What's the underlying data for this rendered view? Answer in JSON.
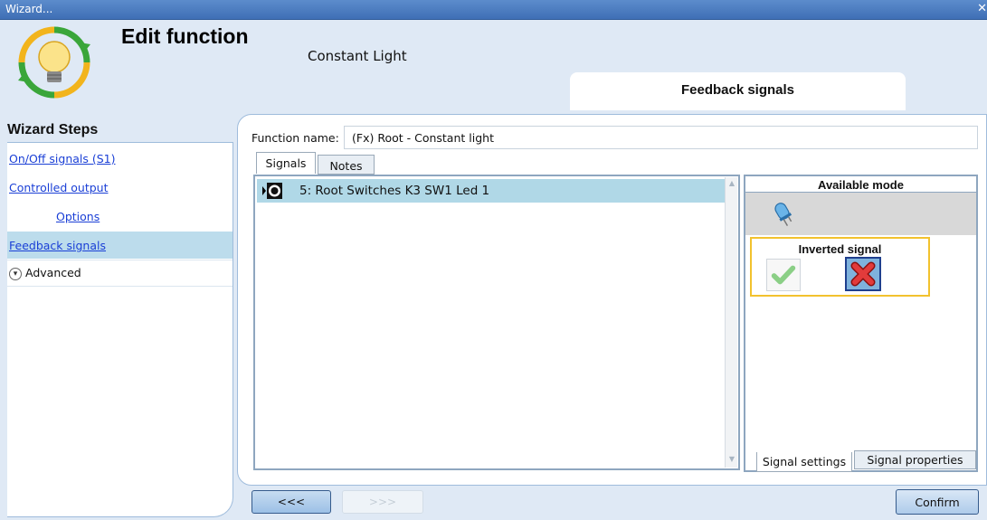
{
  "window": {
    "title": "Wizard..."
  },
  "header": {
    "title": "Edit function",
    "subtitle": "Constant Light",
    "current_step": "Feedback signals"
  },
  "sidebar": {
    "heading": "Wizard Steps",
    "items": [
      {
        "label": "On/Off signals (S1)"
      },
      {
        "label": "Controlled output"
      },
      {
        "label": "Options"
      },
      {
        "label": "Feedback signals"
      },
      {
        "label": "Advanced"
      }
    ]
  },
  "form": {
    "function_name_label": "Function name:",
    "function_name_value": "(Fx) Root - Constant light"
  },
  "tabs": {
    "signals": "Signals",
    "notes": "Notes"
  },
  "signals": {
    "rows": [
      {
        "label": "5: Root Switches K3 SW1 Led 1"
      }
    ]
  },
  "right_panel": {
    "available_mode_label": "Available mode",
    "inverted_signal_label": "Inverted signal",
    "tab_signal_settings": "Signal settings",
    "tab_signal_properties": "Signal properties"
  },
  "buttons": {
    "back": "<<<",
    "forward": ">>>",
    "confirm": "Confirm"
  },
  "colors": {
    "titlebar": "#4a7bc0",
    "selected_row": "#b0d8e7",
    "highlight_border": "#f2c22e",
    "link": "#1a3fd6"
  }
}
